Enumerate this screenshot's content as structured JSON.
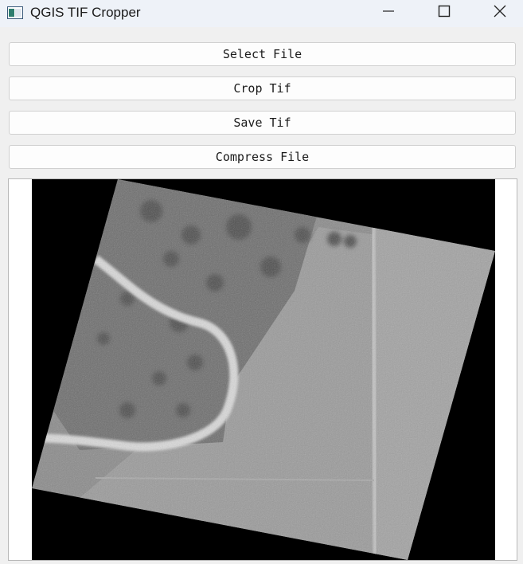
{
  "window": {
    "title": "QGIS TIF Cropper",
    "icon": "app-window-icon",
    "controls": [
      "minimize-icon",
      "maximize-icon",
      "close-icon"
    ]
  },
  "buttons": {
    "select_file": "Select File",
    "crop_tif": "Crop Tif",
    "save_tif": "Save Tif",
    "compress_file": "Compress File"
  },
  "image_view": {
    "content": "grayscale-aerial-raster",
    "background": "#000000"
  }
}
